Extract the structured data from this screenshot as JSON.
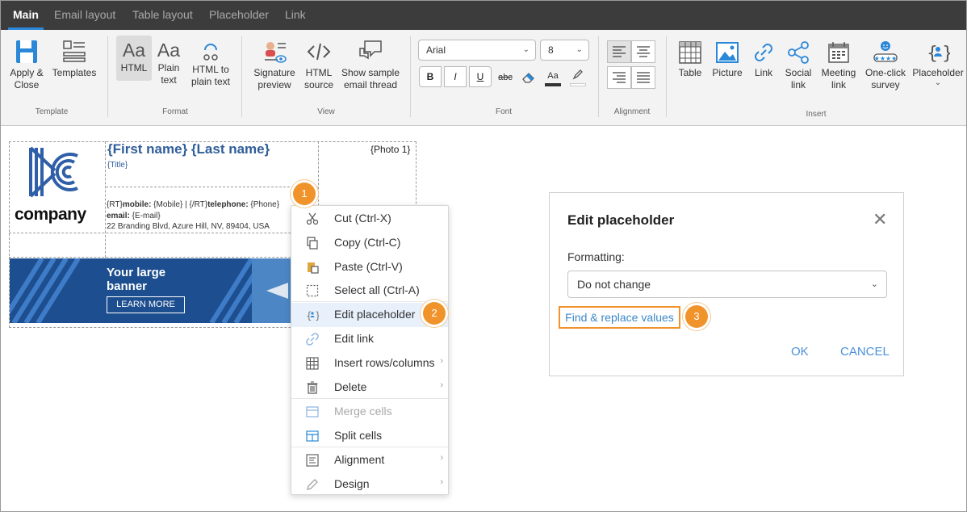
{
  "tabs": [
    {
      "label": "Main",
      "active": true
    },
    {
      "label": "Email layout"
    },
    {
      "label": "Table layout"
    },
    {
      "label": "Placeholder"
    },
    {
      "label": "Link"
    }
  ],
  "ribbon": {
    "template": {
      "label": "Template",
      "apply_close": "Apply &\nClose",
      "templates": "Templates"
    },
    "format": {
      "label": "Format",
      "html": "HTML",
      "plain_text": "Plain\ntext",
      "html_to_plain": "HTML to\nplain text"
    },
    "view": {
      "label": "View",
      "signature_preview": "Signature\npreview",
      "html_source": "HTML\nsource",
      "show_sample": "Show sample\nemail thread"
    },
    "font": {
      "label": "Font",
      "family": "Arial",
      "size": "8",
      "bold": "B",
      "italic": "I",
      "underline": "U",
      "strike": "abc",
      "font_color": "Aa"
    },
    "alignment": {
      "label": "Alignment"
    },
    "insert": {
      "label": "Insert",
      "table": "Table",
      "picture": "Picture",
      "link": "Link",
      "social_link": "Social\nlink",
      "meeting_link": "Meeting\nlink",
      "survey": "One-click\nsurvey",
      "placeholder": "Placeholder"
    }
  },
  "signature": {
    "name": "{First name} {Last name}",
    "title": "{Title}",
    "photo": "{Photo 1}",
    "line1_html": "{RT}<b>mobile:</b> {Mobile}  |  {/RT}<b>telephone:</b> {Phone}",
    "email_label": "email:",
    "email_value": " {E-mail}",
    "address": "22 Branding Blvd, Azure Hill, NV, 89404, USA",
    "logo_text": "company",
    "banner_line1": "Your large",
    "banner_line2": "banner",
    "banner_button": "LEARN MORE"
  },
  "context_menu": [
    {
      "label": "Cut (Ctrl-X)",
      "icon": "cut-icon"
    },
    {
      "label": "Copy (Ctrl-C)",
      "icon": "copy-icon"
    },
    {
      "label": "Paste (Ctrl-V)",
      "icon": "paste-icon"
    },
    {
      "label": "Select all (Ctrl-A)",
      "icon": "select-all-icon"
    },
    {
      "label": "Edit placeholder",
      "icon": "placeholder-icon",
      "highlighted": true
    },
    {
      "label": "Edit link",
      "icon": "link-icon"
    },
    {
      "label": "Insert rows/columns",
      "icon": "table-icon",
      "submenu": true
    },
    {
      "label": "Delete",
      "icon": "trash-icon",
      "submenu": true
    },
    {
      "label": "Merge cells",
      "icon": "merge-icon",
      "disabled": true
    },
    {
      "label": "Split cells",
      "icon": "split-icon"
    },
    {
      "label": "Alignment",
      "icon": "alignment-icon",
      "submenu": true
    },
    {
      "label": "Design",
      "icon": "pencil-icon",
      "submenu": true
    }
  ],
  "dialog": {
    "title": "Edit placeholder",
    "formatting_label": "Formatting:",
    "formatting_value": "Do not change",
    "find_replace": "Find & replace values",
    "ok": "OK",
    "cancel": "CANCEL"
  },
  "badges": [
    "1",
    "2",
    "3"
  ],
  "colors": {
    "accent": "#f0932b",
    "link": "#4a90d9",
    "tab_bar": "#3c3c3c",
    "brand_blue": "#2f5d9a"
  }
}
